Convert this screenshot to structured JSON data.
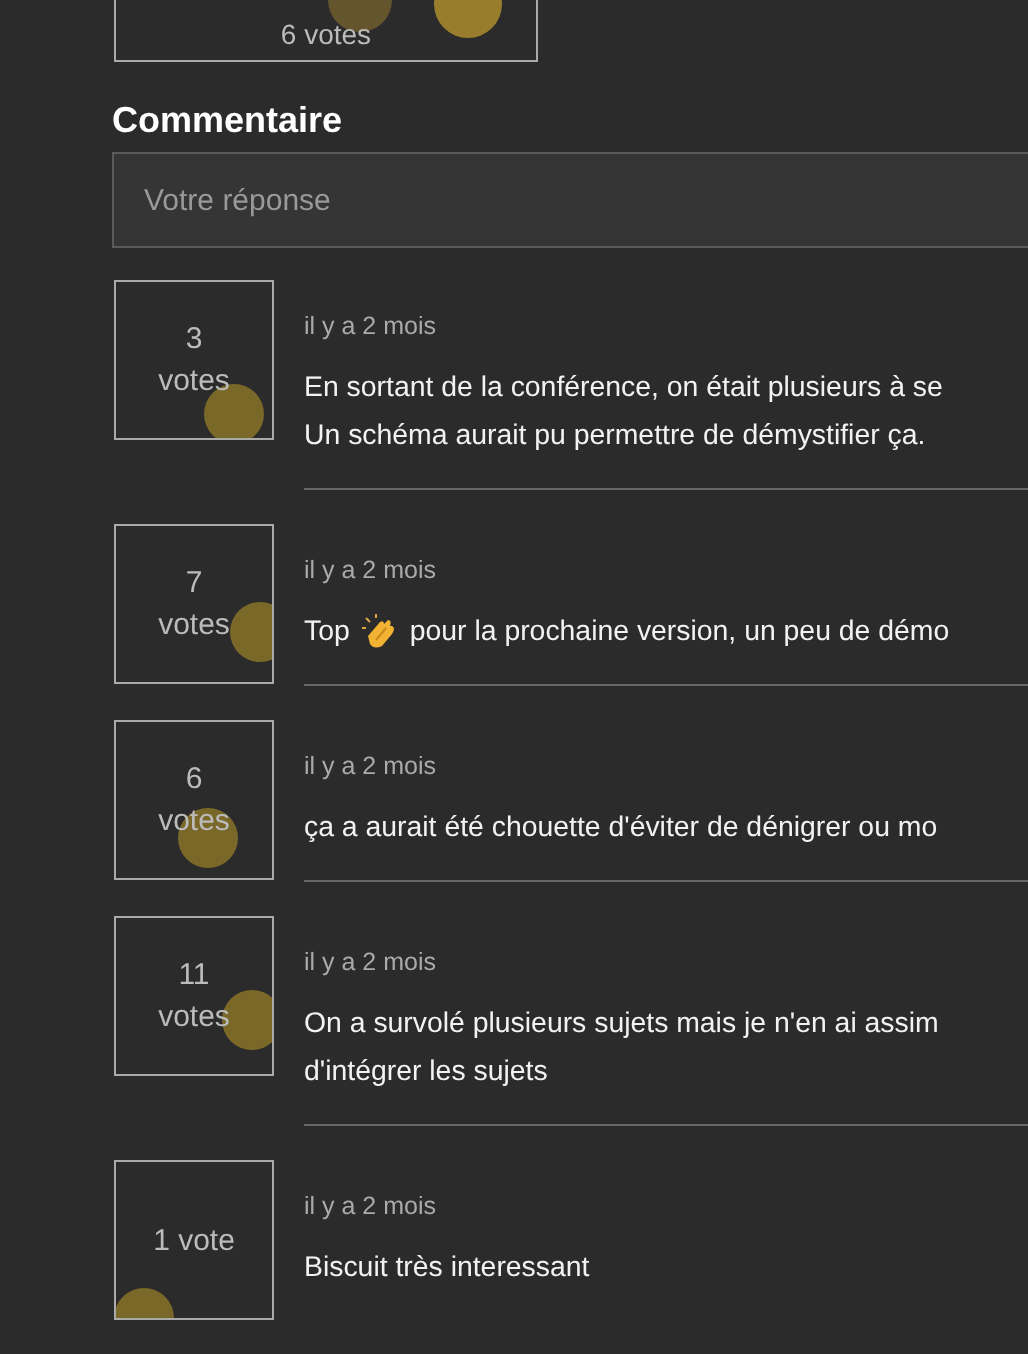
{
  "previous_result": {
    "votes": "6 votes"
  },
  "comment_section": {
    "title": "Commentaire",
    "input": {
      "placeholder": "Votre réponse"
    }
  },
  "comments": [
    {
      "votes": [
        "3",
        "votes"
      ],
      "time": "il y a 2 mois",
      "lines": [
        [
          {
            "kind": "text",
            "text": "En sortant de la conférence, on était plusieurs à se"
          }
        ],
        [
          {
            "kind": "text",
            "text": "Un schéma aurait pu permettre de démystifier ça."
          }
        ]
      ]
    },
    {
      "votes": [
        "7",
        "votes"
      ],
      "time": "il y a 2 mois",
      "lines": [
        [
          {
            "kind": "text",
            "text": "Top"
          },
          {
            "kind": "emoji"
          },
          {
            "kind": "text",
            "text": "pour la prochaine version, un peu de démo"
          }
        ]
      ]
    },
    {
      "votes": [
        "6",
        "votes"
      ],
      "time": "il y a 2 mois",
      "lines": [
        [
          {
            "kind": "text",
            "text": "ça a aurait été chouette d'éviter de dénigrer ou mo"
          }
        ]
      ]
    },
    {
      "votes": [
        "11",
        "votes"
      ],
      "time": "il y a 2 mois",
      "lines": [
        [
          {
            "kind": "text",
            "text": "On a survolé plusieurs sujets mais je n'en ai assim"
          }
        ],
        [
          {
            "kind": "text",
            "text": "d'intégrer les sujets"
          }
        ]
      ]
    },
    {
      "votes": [
        "1 vote"
      ],
      "time": "il y a 2 mois",
      "lines": [
        [
          {
            "kind": "text",
            "text": "Biscuit très interessant"
          }
        ]
      ]
    }
  ]
}
